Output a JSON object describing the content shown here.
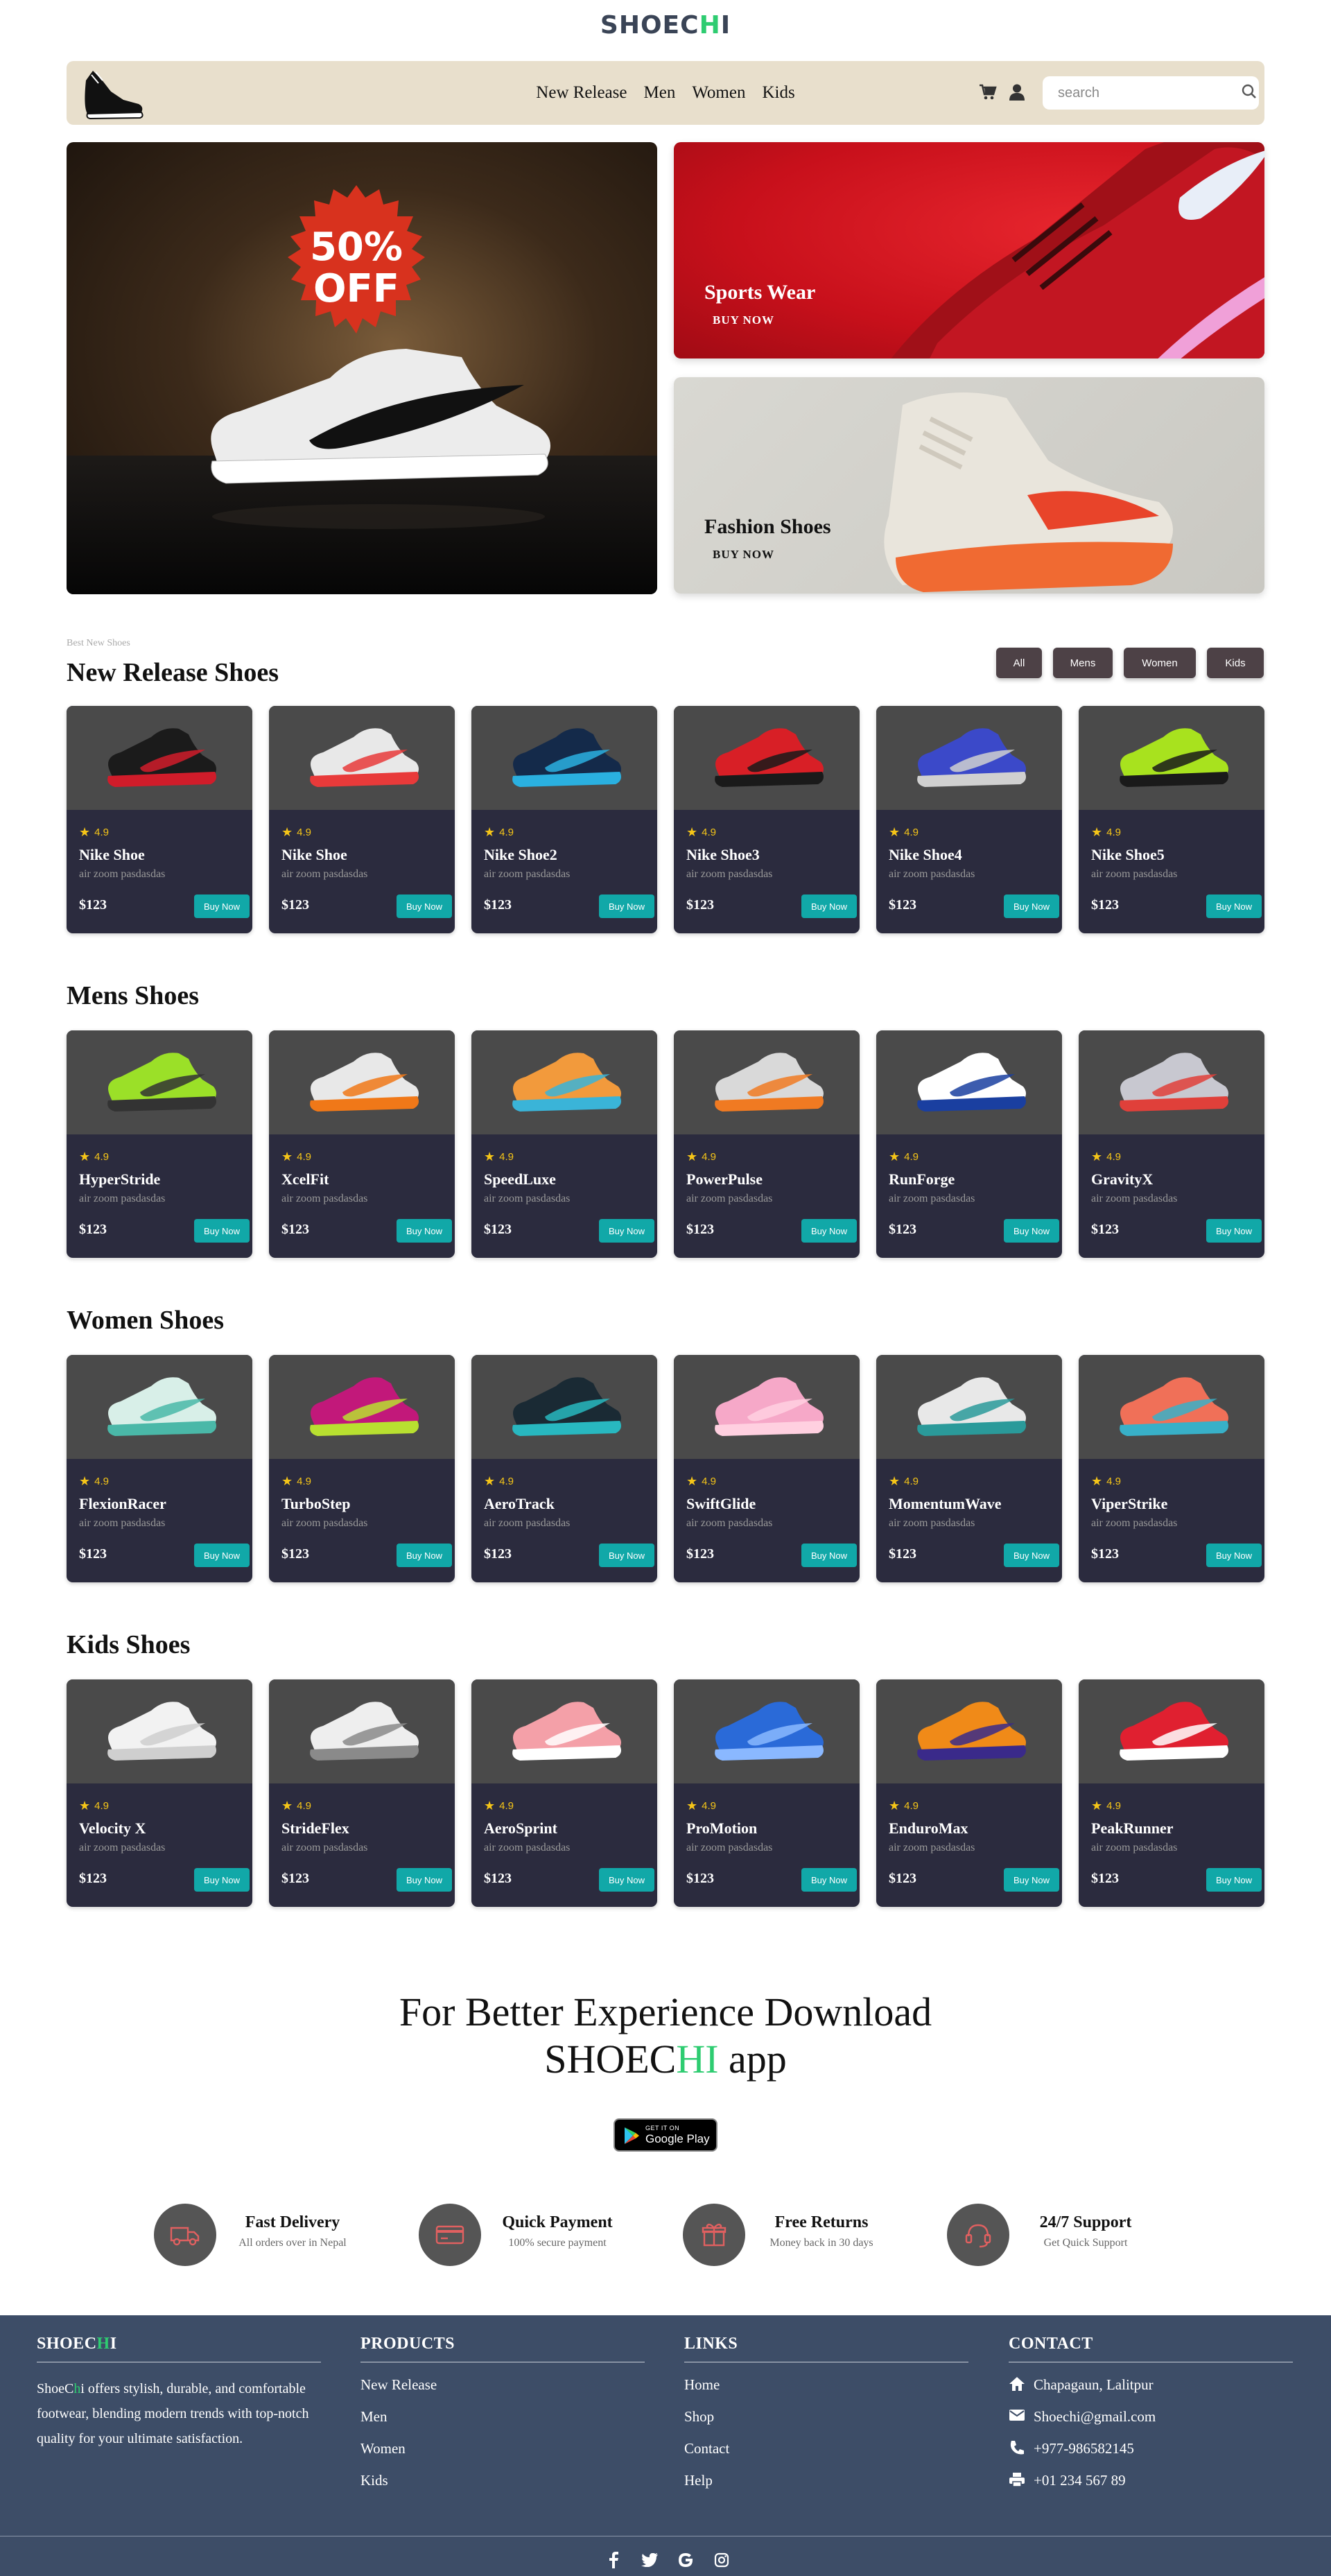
{
  "brand": {
    "prefix": "SHOEC",
    "highlight": "H",
    "suffix": "I"
  },
  "nav": {
    "links": [
      "New Release",
      "Men",
      "Women",
      "Kids"
    ],
    "search_placeholder": "search"
  },
  "hero": {
    "badge_top": "50%",
    "badge_bottom": "OFF",
    "cards": [
      {
        "title": "Sports Wear",
        "cta": "BUY NOW"
      },
      {
        "title": "Fashion Shoes",
        "cta": "BUY NOW"
      }
    ]
  },
  "new_release": {
    "kicker": "Best New Shoes",
    "title": "New Release Shoes",
    "filters": [
      "All",
      "Mens",
      "Women",
      "Kids"
    ]
  },
  "sections": [
    {
      "title": "",
      "products": [
        {
          "name": "Nike Shoe",
          "rating": "4.9",
          "desc": "air zoom pasdasdas",
          "price": "$123",
          "cta": "Buy Now",
          "colors": [
            "#1b1b1b",
            "#d01c2a"
          ]
        },
        {
          "name": "Nike Shoe",
          "rating": "4.9",
          "desc": "air zoom pasdasdas",
          "price": "$123",
          "cta": "Buy Now",
          "colors": [
            "#e8e8e8",
            "#e83a3a"
          ]
        },
        {
          "name": "Nike Shoe2",
          "rating": "4.9",
          "desc": "air zoom pasdasdas",
          "price": "$123",
          "cta": "Buy Now",
          "colors": [
            "#142a4a",
            "#2ab0e0"
          ]
        },
        {
          "name": "Nike Shoe3",
          "rating": "4.9",
          "desc": "air zoom pasdasdas",
          "price": "$123",
          "cta": "Buy Now",
          "colors": [
            "#d81f26",
            "#1a1a1a"
          ]
        },
        {
          "name": "Nike Shoe4",
          "rating": "4.9",
          "desc": "air zoom pasdasdas",
          "price": "$123",
          "cta": "Buy Now",
          "colors": [
            "#3b49c9",
            "#d0d0d0"
          ]
        },
        {
          "name": "Nike Shoe5",
          "rating": "4.9",
          "desc": "air zoom pasdasdas",
          "price": "$123",
          "cta": "Buy Now",
          "colors": [
            "#a8e21e",
            "#1a1a1a"
          ]
        }
      ]
    },
    {
      "title": "Mens Shoes",
      "products": [
        {
          "name": "HyperStride",
          "rating": "4.9",
          "desc": "air zoom pasdasdas",
          "price": "$123",
          "cta": "Buy Now",
          "colors": [
            "#9be028",
            "#333333"
          ]
        },
        {
          "name": "XcelFit",
          "rating": "4.9",
          "desc": "air zoom pasdasdas",
          "price": "$123",
          "cta": "Buy Now",
          "colors": [
            "#e8e8e8",
            "#f07818"
          ]
        },
        {
          "name": "SpeedLuxe",
          "rating": "4.9",
          "desc": "air zoom pasdasdas",
          "price": "$123",
          "cta": "Buy Now",
          "colors": [
            "#f29a3c",
            "#3ab4d8"
          ]
        },
        {
          "name": "PowerPulse",
          "rating": "4.9",
          "desc": "air zoom pasdasdas",
          "price": "$123",
          "cta": "Buy Now",
          "colors": [
            "#d9d9d9",
            "#f07a22"
          ]
        },
        {
          "name": "RunForge",
          "rating": "4.9",
          "desc": "air zoom pasdasdas",
          "price": "$123",
          "cta": "Buy Now",
          "colors": [
            "#ffffff",
            "#1a3fa0"
          ]
        },
        {
          "name": "GravityX",
          "rating": "4.9",
          "desc": "air zoom pasdasdas",
          "price": "$123",
          "cta": "Buy Now",
          "colors": [
            "#c8c8d0",
            "#e0403a"
          ]
        }
      ]
    },
    {
      "title": "Women Shoes",
      "products": [
        {
          "name": "FlexionRacer",
          "rating": "4.9",
          "desc": "air zoom pasdasdas",
          "price": "$123",
          "cta": "Buy Now",
          "colors": [
            "#d8efe8",
            "#4ab8a8"
          ]
        },
        {
          "name": "TurboStep",
          "rating": "4.9",
          "desc": "air zoom pasdasdas",
          "price": "$123",
          "cta": "Buy Now",
          "colors": [
            "#c2187a",
            "#b8e030"
          ]
        },
        {
          "name": "AeroTrack",
          "rating": "4.9",
          "desc": "air zoom pasdasdas",
          "price": "$123",
          "cta": "Buy Now",
          "colors": [
            "#1a2a34",
            "#28b8c0"
          ]
        },
        {
          "name": "SwiftGlide",
          "rating": "4.9",
          "desc": "air zoom pasdasdas",
          "price": "$123",
          "cta": "Buy Now",
          "colors": [
            "#f6a8c8",
            "#ffd0e0"
          ]
        },
        {
          "name": "MomentumWave",
          "rating": "4.9",
          "desc": "air zoom pasdasdas",
          "price": "$123",
          "cta": "Buy Now",
          "colors": [
            "#e8e8e8",
            "#2a9a9a"
          ]
        },
        {
          "name": "ViperStrike",
          "rating": "4.9",
          "desc": "air zoom pasdasdas",
          "price": "$123",
          "cta": "Buy Now",
          "colors": [
            "#f07058",
            "#38b0c8"
          ]
        }
      ]
    },
    {
      "title": "Kids Shoes",
      "products": [
        {
          "name": "Velocity X",
          "rating": "4.9",
          "desc": "air zoom pasdasdas",
          "price": "$123",
          "cta": "Buy Now",
          "colors": [
            "#f2f2f2",
            "#cfcfcf"
          ]
        },
        {
          "name": "StrideFlex",
          "rating": "4.9",
          "desc": "air zoom pasdasdas",
          "price": "$123",
          "cta": "Buy Now",
          "colors": [
            "#eeeeee",
            "#8a8a8a"
          ]
        },
        {
          "name": "AeroSprint",
          "rating": "4.9",
          "desc": "air zoom pasdasdas",
          "price": "$123",
          "cta": "Buy Now",
          "colors": [
            "#f4a0a8",
            "#ffffff"
          ]
        },
        {
          "name": "ProMotion",
          "rating": "4.9",
          "desc": "air zoom pasdasdas",
          "price": "$123",
          "cta": "Buy Now",
          "colors": [
            "#2a6ad8",
            "#8ab8ff"
          ]
        },
        {
          "name": "EnduroMax",
          "rating": "4.9",
          "desc": "air zoom pasdasdas",
          "price": "$123",
          "cta": "Buy Now",
          "colors": [
            "#f08a18",
            "#3a2a8a"
          ]
        },
        {
          "name": "PeakRunner",
          "rating": "4.9",
          "desc": "air zoom pasdasdas",
          "price": "$123",
          "cta": "Buy Now",
          "colors": [
            "#e02030",
            "#ffffff"
          ]
        }
      ]
    }
  ],
  "promo": {
    "line1": "For Better Experience Download",
    "app_prefix": "SHOEC",
    "app_highlight": "HI",
    "app_suffix": " app",
    "badge_small": "GET IT ON",
    "badge_big": "Google Play"
  },
  "features": [
    {
      "icon": "truck-icon",
      "title": "Fast Delivery",
      "subtitle": "All orders over in Nepal"
    },
    {
      "icon": "credit-card-icon",
      "title": "Quick Payment",
      "subtitle": "100% secure payment"
    },
    {
      "icon": "gift-box-icon",
      "title": "Free Returns",
      "subtitle": "Money back in 30 days"
    },
    {
      "icon": "support-icon",
      "title": "24/7 Support",
      "subtitle": "Get Quick Support"
    }
  ],
  "footer": {
    "about_title_prefix": "SHOEC",
    "about_title_highlight": "H",
    "about_title_suffix": "I",
    "about_prefix": "ShoeC",
    "about_highlight": "h",
    "about_text": "i offers stylish, durable, and comfortable footwear, blending modern trends with top-notch quality for your ultimate satisfaction.",
    "products_title": "PRODUCTS",
    "products": [
      "New Release",
      "Men",
      "Women",
      "Kids"
    ],
    "links_title": "LINKS",
    "links": [
      "Home",
      "Shop",
      "Contact",
      "Help"
    ],
    "contact_title": "CONTACT",
    "contact": [
      {
        "icon": "home-icon",
        "text": "Chapagaun, Lalitpur"
      },
      {
        "icon": "mail-icon",
        "text": "Shoechi@gmail.com"
      },
      {
        "icon": "phone-icon",
        "text": "+977-986582145"
      },
      {
        "icon": "fax-icon",
        "text": "+01 234 567 89"
      }
    ],
    "socials": [
      "facebook-icon",
      "twitter-icon",
      "google-icon",
      "instagram-icon"
    ]
  },
  "colors": {
    "accent": "#2ecc71",
    "button": "#11a8a8",
    "card": "#2b2b3e",
    "card_image": "#4a4a4a",
    "footer": "#3d4d67",
    "navbar": "#e8dfcc",
    "star": "#f5c518"
  }
}
